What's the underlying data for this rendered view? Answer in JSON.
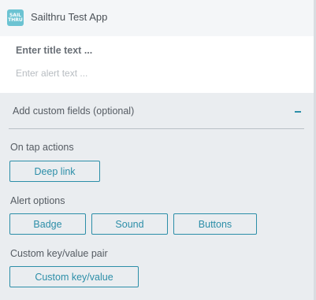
{
  "header": {
    "app_icon_text_line1": "SAIL",
    "app_icon_text_line2": "THRU",
    "app_name": "Sailthru Test App"
  },
  "notification": {
    "title_placeholder": "Enter title text ...",
    "alert_placeholder": "Enter alert text ..."
  },
  "custom_fields": {
    "label": "Add custom fields (optional)",
    "toggle_icon": "minus-icon"
  },
  "on_tap": {
    "label": "On tap actions",
    "buttons": [
      "Deep link"
    ]
  },
  "alert_options": {
    "label": "Alert options",
    "buttons": [
      "Badge",
      "Sound",
      "Buttons"
    ]
  },
  "custom_pair": {
    "label": "Custom key/value pair",
    "button": "Custom key/value"
  },
  "colors": {
    "accent": "#2c8ea8",
    "app_icon": "#6cc3d2",
    "background": "#eaedf0"
  }
}
